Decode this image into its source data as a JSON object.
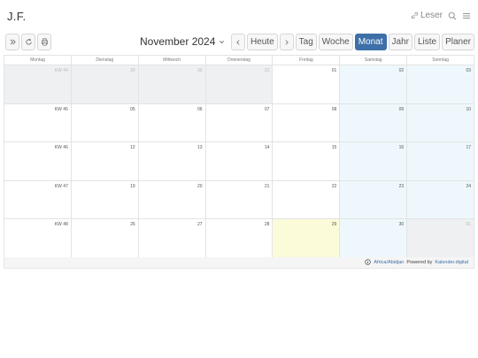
{
  "app": {
    "brand": "J.F."
  },
  "topright": {
    "reader_label": "Leser"
  },
  "toolbar": {
    "month_title": "November 2024",
    "today_label": "Heute",
    "views": [
      {
        "label": "Tag",
        "active": false
      },
      {
        "label": "Woche",
        "active": false
      },
      {
        "label": "Monat",
        "active": true
      },
      {
        "label": "Jahr",
        "active": false
      },
      {
        "label": "Liste",
        "active": false
      },
      {
        "label": "Planer",
        "active": false
      }
    ]
  },
  "calendar": {
    "weekdays": [
      "Montag",
      "Dienstag",
      "Mittwoch",
      "Donnerstag",
      "Freitag",
      "Samstag",
      "Sonntag"
    ],
    "weeks": [
      {
        "kw": "KW 44",
        "days": [
          {
            "n": "29",
            "other": true
          },
          {
            "n": "30",
            "other": true
          },
          {
            "n": "31",
            "other": true
          },
          {
            "n": "01"
          },
          {
            "n": "02",
            "weekend": true
          },
          {
            "n": "03",
            "weekend": true
          }
        ]
      },
      {
        "kw": "KW 45",
        "days": [
          {
            "n": "05"
          },
          {
            "n": "06"
          },
          {
            "n": "07"
          },
          {
            "n": "08"
          },
          {
            "n": "09",
            "weekend": true
          },
          {
            "n": "10",
            "weekend": true
          }
        ]
      },
      {
        "kw": "KW 46",
        "days": [
          {
            "n": "12"
          },
          {
            "n": "13"
          },
          {
            "n": "14"
          },
          {
            "n": "15"
          },
          {
            "n": "16",
            "weekend": true
          },
          {
            "n": "17",
            "weekend": true
          }
        ]
      },
      {
        "kw": "KW 47",
        "days": [
          {
            "n": "19"
          },
          {
            "n": "20"
          },
          {
            "n": "21"
          },
          {
            "n": "22"
          },
          {
            "n": "23",
            "weekend": true
          },
          {
            "n": "24",
            "weekend": true
          }
        ]
      },
      {
        "kw": "KW 48",
        "days": [
          {
            "n": "26"
          },
          {
            "n": "27"
          },
          {
            "n": "28"
          },
          {
            "n": "29",
            "today": true
          },
          {
            "n": "30",
            "weekend": true
          },
          {
            "n": "01",
            "other": true
          }
        ]
      }
    ]
  },
  "footer": {
    "timezone": "Africa/Abidjan",
    "powered_by": "Powered by",
    "brand_link": "Kalender.digital"
  },
  "colors": {
    "accent": "#3d6fa8",
    "today": "#fbfbd9",
    "weekend": "#eef8fc",
    "other_month": "#eff0f2"
  }
}
